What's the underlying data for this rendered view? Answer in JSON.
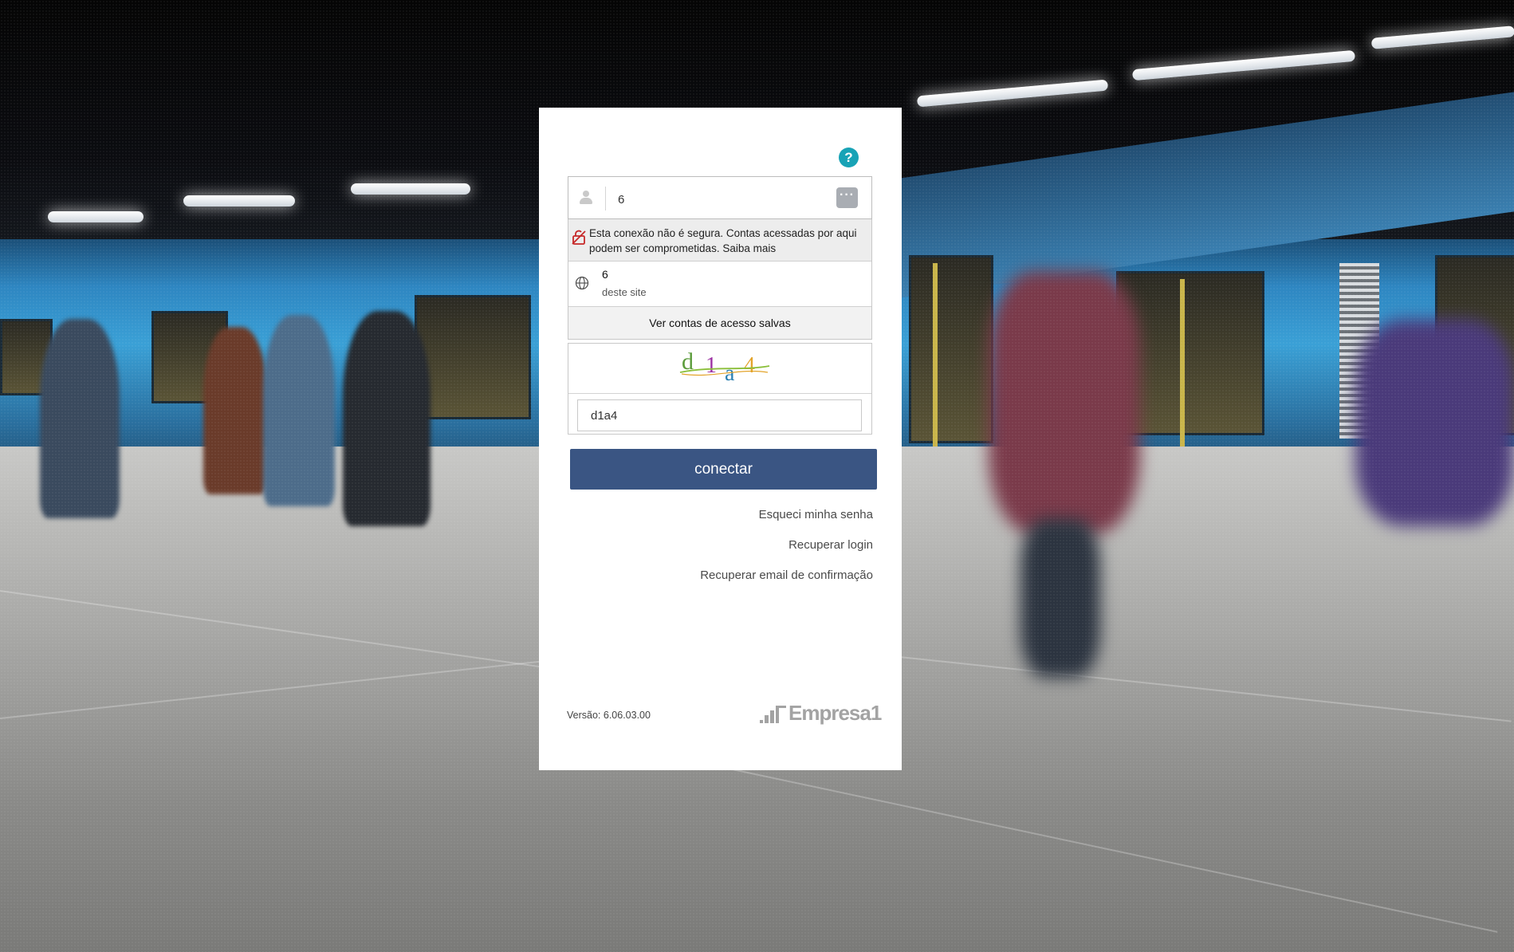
{
  "login": {
    "username_value": "6",
    "password_manager_icon": "dots-icon",
    "user_icon": "user-icon"
  },
  "autofill": {
    "warning_text": "Esta conexão não é segura. Contas acessadas por aqui podem ser comprometidas.",
    "learn_more": "Saiba mais",
    "account_name": "6",
    "account_source": "deste site",
    "view_saved": "Ver contas de acesso salvas"
  },
  "captcha": {
    "image_text": "d1a4",
    "value": "d1a4",
    "colors": [
      "#5c9c3c",
      "#9b2fa2",
      "#2a7fb0",
      "#e3a42b"
    ]
  },
  "actions": {
    "connect_label": "conectar",
    "forgot_password": "Esqueci minha senha",
    "recover_login": "Recuperar login",
    "recover_email": "Recuperar email de confirmação"
  },
  "footer": {
    "version": "Versão: 6.06.03.00",
    "brand": "Empresa1"
  },
  "colors": {
    "primary": "#3a5583",
    "help": "#18a3b6"
  }
}
